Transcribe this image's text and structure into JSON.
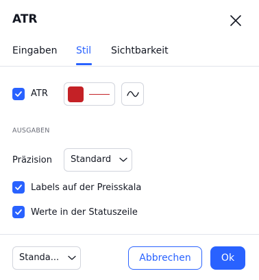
{
  "dialog": {
    "title": "ATR",
    "tabs": [
      {
        "label": "Eingaben",
        "active": false
      },
      {
        "label": "Stil",
        "active": true
      },
      {
        "label": "Sichtbarkeit",
        "active": false
      }
    ]
  },
  "style": {
    "atr_label": "ATR",
    "atr_checked": true,
    "line_color": "#c42126",
    "section_title": "AUSGABEN",
    "precision_label": "Präzision",
    "precision_value": "Standard",
    "labels_on_scale": "Labels auf der Preisskala",
    "labels_on_scale_checked": true,
    "values_in_status": "Werte in der Statuszeile",
    "values_in_status_checked": true
  },
  "footer": {
    "template_value": "Standa...",
    "cancel_label": "Abbrechen",
    "ok_label": "Ok"
  },
  "colors": {
    "accent": "#2962ff",
    "text": "#131722",
    "muted": "#6a6d78",
    "border": "#d1d4dc"
  }
}
